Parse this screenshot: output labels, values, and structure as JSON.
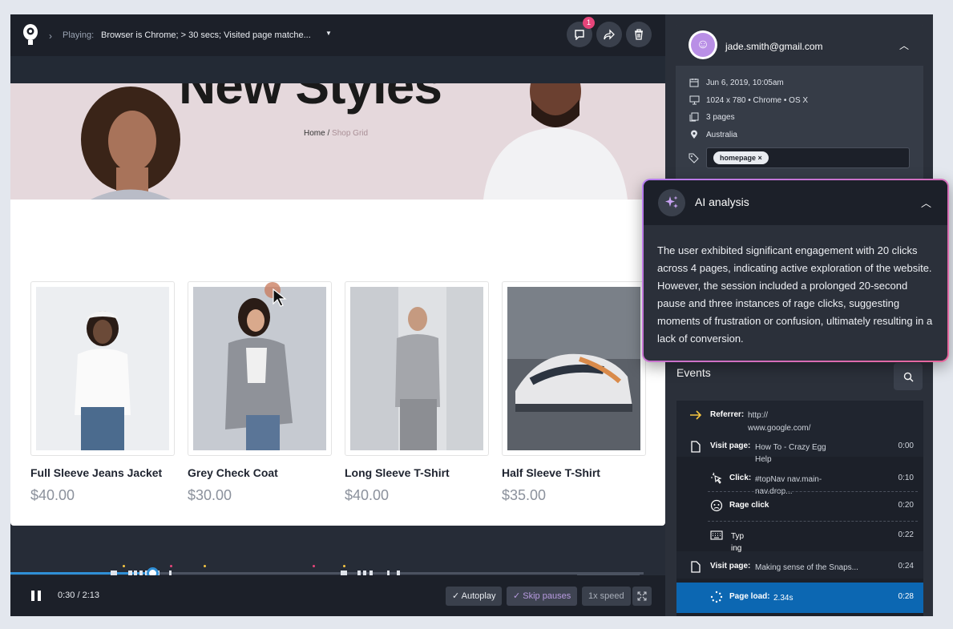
{
  "topbar": {
    "playing_label": "Playing:",
    "filter_text": "Browser is Chrome; > 30 secs; Visited page matche...",
    "comment_badge": "1"
  },
  "site": {
    "hero_title": "New Styles",
    "breadcrumb_home": "Home",
    "breadcrumb_sep": " / ",
    "breadcrumb_current": "Shop Grid",
    "products": [
      {
        "name": "Full Sleeve Jeans Jacket",
        "price": "$40.00"
      },
      {
        "name": "Grey Check Coat",
        "price": "$30.00"
      },
      {
        "name": "Long Sleeve T-Shirt",
        "price": "$40.00"
      },
      {
        "name": "Half Sleeve T-Shirt",
        "price": "$35.00"
      }
    ]
  },
  "player": {
    "time": "0:30 / 2:13",
    "progress": 0.2256,
    "autoplay_label": "✓ Autoplay",
    "skip_label": "✓ Skip pauses",
    "speed_label": "1x speed"
  },
  "session": {
    "email": "jade.smith@gmail.com",
    "date": "Jun 6, 2019, 10:05am",
    "device": "1024 x 780 • Chrome • OS X",
    "pages": "3 pages",
    "location": "Australia",
    "tag": "homepage ×"
  },
  "ai": {
    "title": "AI analysis",
    "body": "The user exhibited significant engagement with 20 clicks across 4 pages, indicating active exploration of the website. However, the session included a prolonged 20-second pause and three instances of rage clicks, suggesting moments of frustration or confusion, ultimately resulting in a lack of conversion."
  },
  "events": {
    "title": "Events",
    "items": [
      {
        "label": "Referrer:",
        "value": "http://\nwww.google.com/",
        "time": ""
      },
      {
        "label": "Visit page:",
        "value": "How To - Crazy Egg\nHelp",
        "time": "0:00"
      },
      {
        "label": "Click:",
        "value": "#topNav nav.main-\nnav.drop...",
        "time": "0:10"
      },
      {
        "label": "Rage click",
        "value": "",
        "time": "0:20"
      },
      {
        "label": "Typ\ning",
        "value": "",
        "time": "0:22"
      },
      {
        "label": "Visit page:",
        "value": "Making sense of the Snaps...",
        "time": "0:24"
      },
      {
        "label": "Page load:",
        "value": "2.34s",
        "time": "0:28"
      }
    ]
  },
  "colors": {
    "accent_blue": "#2f8fd6",
    "highlight_blue": "#0c67b2",
    "ai_gradient_start": "#b57cf0",
    "ai_gradient_end": "#e7669b",
    "badge_pink": "#e6457a"
  }
}
